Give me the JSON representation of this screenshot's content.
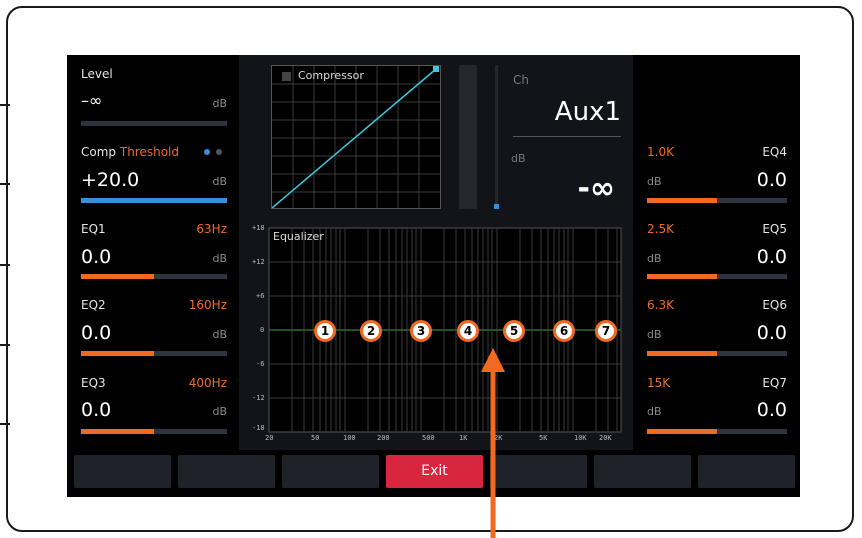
{
  "left": {
    "level": {
      "label": "Level",
      "value": "–∞",
      "unit": "dB",
      "fill": 0
    },
    "comp": {
      "label": "Comp",
      "param": "Threshold",
      "value": "+20.0",
      "unit": "dB",
      "fill": 1.0
    },
    "eq": [
      {
        "label": "EQ1",
        "freq": "63Hz",
        "value": "0.0",
        "unit": "dB",
        "fill": 0.5
      },
      {
        "label": "EQ2",
        "freq": "160Hz",
        "value": "0.0",
        "unit": "dB",
        "fill": 0.5
      },
      {
        "label": "EQ3",
        "freq": "400Hz",
        "value": "0.0",
        "unit": "dB",
        "fill": 0.5
      }
    ]
  },
  "right": {
    "eq": [
      {
        "label": "EQ4",
        "freq": "1.0K",
        "value": "0.0",
        "unit": "dB",
        "fill": 0.5
      },
      {
        "label": "EQ5",
        "freq": "2.5K",
        "value": "0.0",
        "unit": "dB",
        "fill": 0.5
      },
      {
        "label": "EQ6",
        "freq": "6.3K",
        "value": "0.0",
        "unit": "dB",
        "fill": 0.5
      },
      {
        "label": "EQ7",
        "freq": "15K",
        "value": "0.0",
        "unit": "dB",
        "fill": 0.5
      }
    ]
  },
  "compressor": {
    "title": "Compressor"
  },
  "channel": {
    "ch_label": "Ch",
    "name": "Aux1",
    "unit": "dB",
    "level": "-∞"
  },
  "equalizer": {
    "title": "Equalizer",
    "y_ticks": [
      "+18",
      "+12",
      "+6",
      "0",
      "-6",
      "-12",
      "-18"
    ],
    "x_ticks": [
      "20",
      "50",
      "100",
      "200",
      "500",
      "1K",
      "2K",
      "5K",
      "10K",
      "20K"
    ],
    "nodes": [
      "1",
      "2",
      "3",
      "4",
      "5",
      "6",
      "7"
    ]
  },
  "softkeys": [
    "",
    "",
    "",
    "Exit",
    "",
    "",
    ""
  ],
  "colors": {
    "accent": "#f26a21",
    "comp": "#3b8fd6",
    "exit": "#d7263d"
  }
}
